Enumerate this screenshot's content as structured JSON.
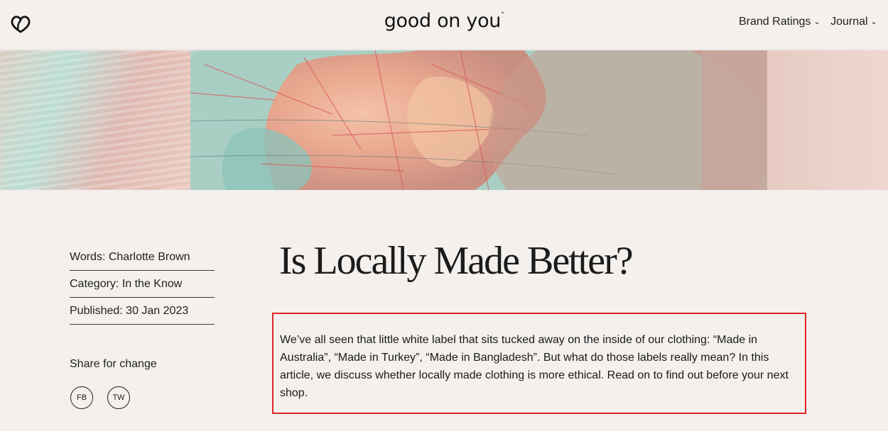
{
  "header": {
    "brand": "good on you",
    "brand_mark": "°",
    "nav": [
      {
        "label": "Brand Ratings",
        "icon": "chevron-down-icon"
      },
      {
        "label": "Journal",
        "icon": "chevron-down-icon"
      }
    ]
  },
  "article": {
    "title": "Is Locally Made Better?",
    "meta": [
      "Words: Charlotte Brown",
      "Category: In the Know",
      "Published: 30 Jan 2023"
    ],
    "share_label": "Share for change",
    "share_buttons": [
      "FB",
      "TW"
    ],
    "intro": "We’ve all seen that little white label that sits tucked away on the inside of our clothing: “Made in Australia”, “Made in Turkey”, “Made in Bangladesh”. But what do those labels really mean? In this article, we discuss whether locally made clothing is more ethical. Read on to find out before your next shop."
  },
  "colors": {
    "background": "#f3f0ed",
    "highlight_border": "#e0252b"
  }
}
